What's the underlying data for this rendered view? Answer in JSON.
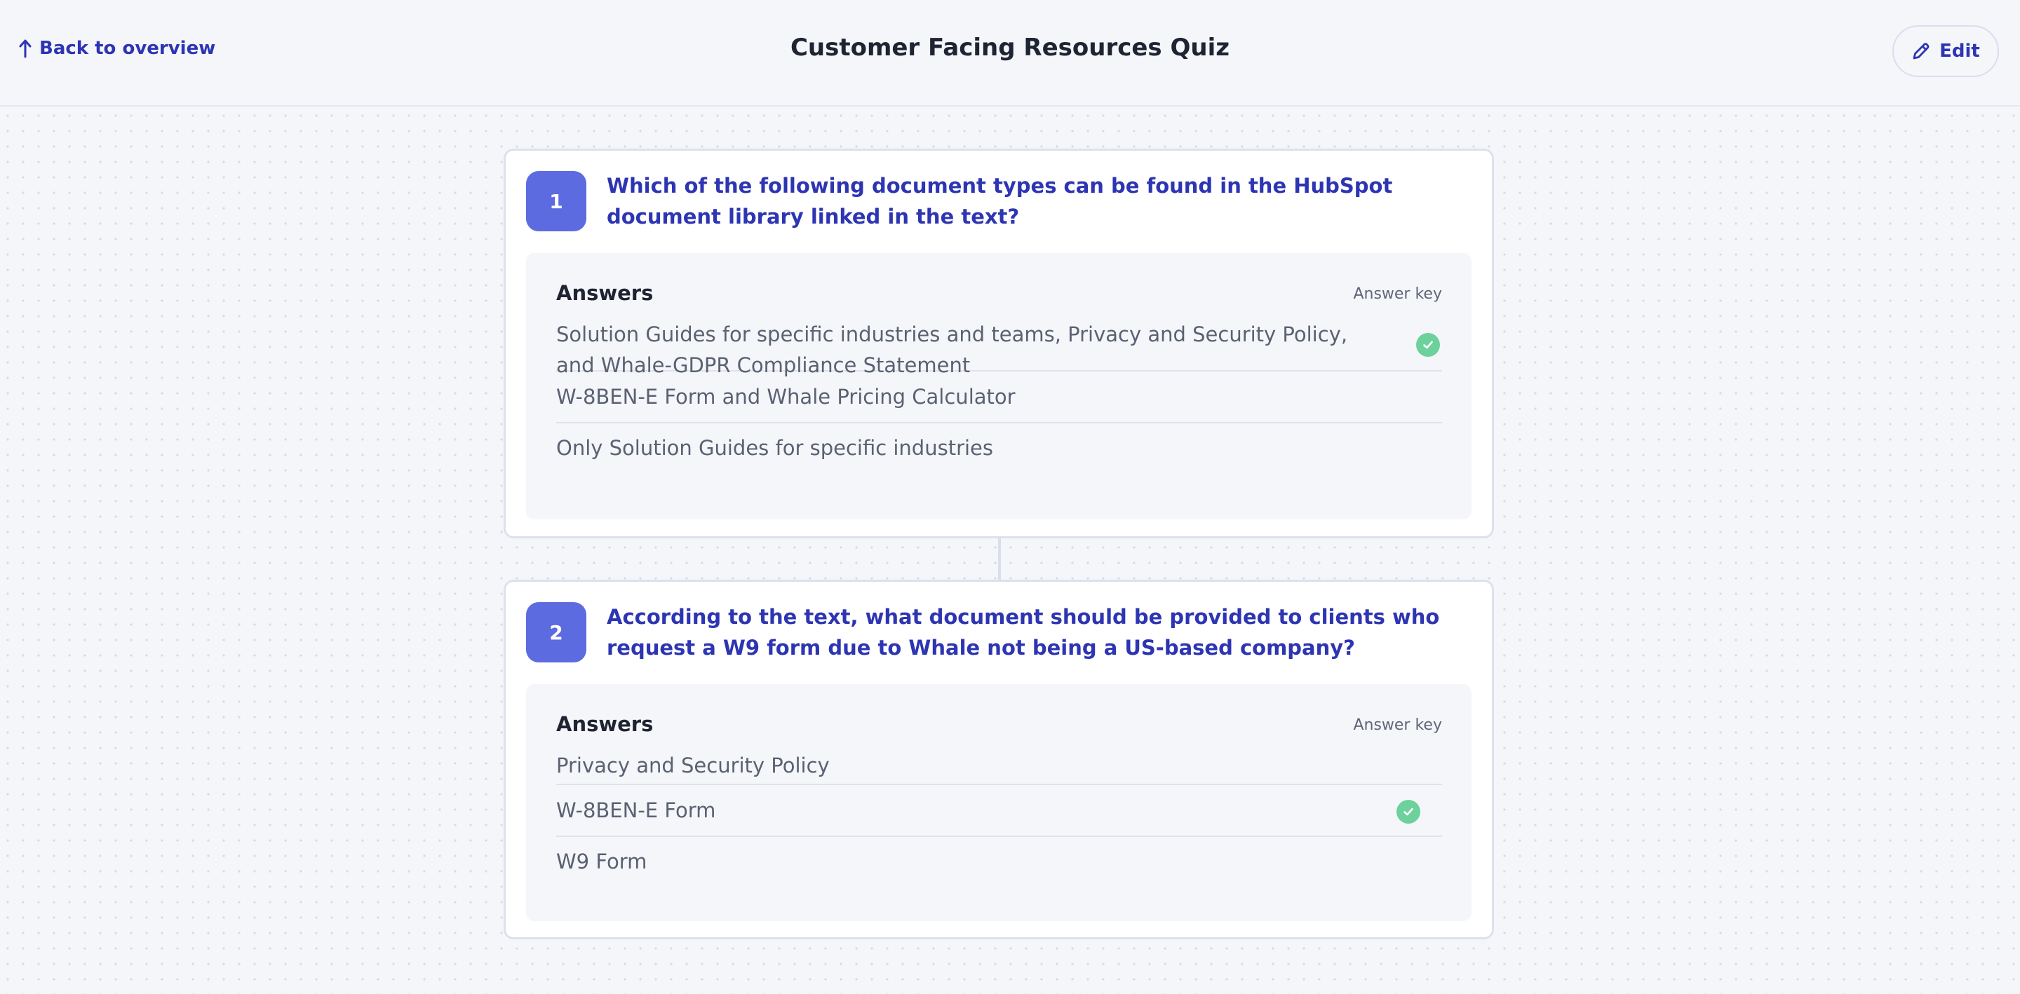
{
  "header": {
    "back_label": "Back to overview",
    "title": "Customer Facing Resources Quiz",
    "edit_label": "Edit"
  },
  "questions": [
    {
      "number": "1",
      "text": "Which of the following document types can be found in the HubSpot document library linked in the text?",
      "answers_title": "Answers",
      "answer_key_label": "Answer key",
      "answers": [
        {
          "text": "Solution Guides for specific industries and teams, Privacy and Security Policy, and Whale-GDPR Compliance Statement",
          "correct": true
        },
        {
          "text": "W-8BEN-E Form and Whale Pricing Calculator",
          "correct": false
        },
        {
          "text": "Only Solution Guides for specific industries",
          "correct": false
        }
      ]
    },
    {
      "number": "2",
      "text": "According to the text, what document should be provided to clients who request a W9 form due to Whale not being a US-based company?",
      "answers_title": "Answers",
      "answer_key_label": "Answer key",
      "answers": [
        {
          "text": "Privacy and Security Policy",
          "correct": false
        },
        {
          "text": "W-8BEN-E Form",
          "correct": true
        },
        {
          "text": "W9 Form",
          "correct": false
        }
      ]
    }
  ],
  "colors": {
    "accent": "#2d35b3",
    "number_badge": "#5d6be0",
    "correct": "#6dd19c",
    "background": "#f5f6fa"
  },
  "icons": {
    "back": "arrow-up-left-icon",
    "edit": "pencil-icon",
    "correct": "check-circle-icon"
  }
}
